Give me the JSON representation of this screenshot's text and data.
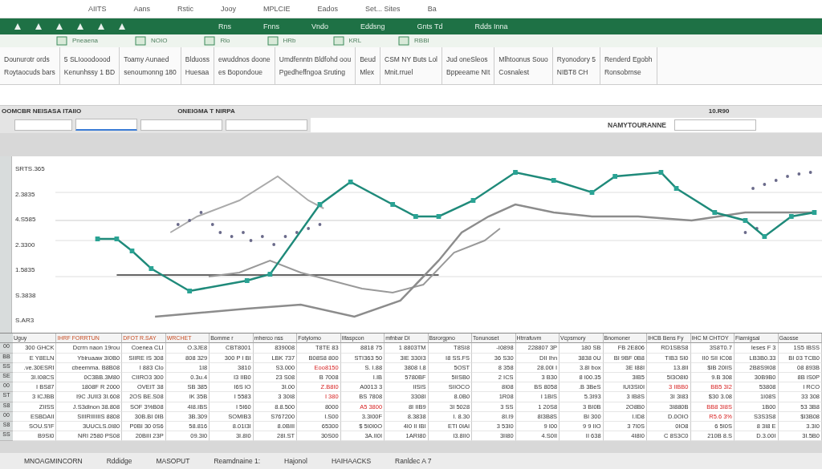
{
  "title_bar": {
    "items": [
      "AIITS",
      "Aans",
      "Rstic",
      "Jooy",
      "MPLCIE",
      "Eados",
      "Set... Sites",
      "Ba"
    ]
  },
  "ribbon_tabs": {
    "items": [
      "Rns",
      "Fnns",
      "Vndo",
      "Eddsng",
      "Gnts Td",
      "Rdds Inna"
    ]
  },
  "ribbon": {
    "top_labels": [
      "Pneaena",
      "NOIO",
      "Rlo",
      "HRb",
      "KRL",
      "RBBI"
    ],
    "groups": [
      {
        "lines": [
          "Dounurotr ords",
          "Roytaocuds bars"
        ]
      },
      {
        "lines": [
          "5 SLIooodoood",
          "Kenunhssy 1 BD"
        ]
      },
      {
        "lines": [
          "Toamy Aunaed",
          "senoumonng 180"
        ]
      },
      {
        "lines": [
          "Blduoss",
          "Huesaa"
        ]
      },
      {
        "lines": [
          "ewuddnos doone",
          "es Bopondoue"
        ]
      },
      {
        "lines": [
          "Umdfenntn Bldfohd oou",
          "Pgedheffngoa Sruting"
        ]
      },
      {
        "lines": [
          "Beud",
          "Mlex"
        ]
      },
      {
        "lines": [
          "CSM NY Buts Lol",
          "Mnit.rruel"
        ]
      },
      {
        "lines": [
          "Jud oneSleos",
          "Bppeeame NIt"
        ]
      },
      {
        "lines": [
          "Mlhtoonus Souo",
          "Cosnalest"
        ]
      },
      {
        "lines": [
          "Ryonodory 5",
          "NIBT8 CH"
        ]
      },
      {
        "lines": [
          "Renderd Egobh",
          "Ronsobrnse"
        ]
      }
    ]
  },
  "labels_row": {
    "left": "OOMCBR NEISASA ITAIIO",
    "middle": "ONEIGMA T NIRPA",
    "right": "10.R90"
  },
  "formula_bar": {
    "label": "NAMYTOURANNE"
  },
  "chart": {
    "y_labels": [
      "SRTS.365",
      "2.3835",
      "4.S585",
      "2.3300",
      "1.5835",
      "S.3838",
      "S.AR3"
    ]
  },
  "table": {
    "columns": [
      "Uguy",
      "IHRF FORRTUN",
      "DFOT R.SAY",
      "WRCHET",
      "Bomme r",
      "mherco nss",
      "Fotyiomo",
      "Ilfaspcon",
      "mfnbar Dl",
      "Bsrorgpno",
      "Tonunoset",
      "Htrrafuvm",
      "Vcpsrnory",
      "Bnomoner",
      "IHCB Bens Fy",
      "IHC M CHTOY",
      "Fiarnigsal",
      "Gaosse"
    ],
    "rows": [
      {
        "num": "00",
        "cells": [
          "300 GHCK",
          "Dcrrn naon 19rou",
          "Coenea CLI",
          "O.3JE8",
          "CBT8001",
          "839008",
          "T8TE 83",
          "8818 75",
          "1 8803TM",
          "T8SI8",
          "-I0898",
          "228807 3P",
          "180 SB",
          "FB 2E806",
          "RD1SBS8",
          "3S8T0.7",
          "Ieses F 3",
          "1S5 IBSS"
        ],
        "negative": [
          false,
          false,
          false,
          false,
          false,
          false,
          false,
          false,
          false,
          false,
          false,
          false,
          false,
          false,
          false,
          false,
          false,
          false
        ]
      },
      {
        "num": "BB",
        "cells": [
          "E Y8ELN",
          "Ybiruaaw 3I0B0",
          "SIIRE IS 308",
          "808 329",
          "300 P I BI",
          "LBK 737",
          "B08S8 800",
          "STI363 50",
          "3IE 330I3",
          "I8 SS.FS",
          "36 S30",
          "DII Ihn",
          "3838 0U",
          "BI 9BF 0B8",
          "TIB3 SI0",
          "II0 SII IC08",
          "LB3B0.33",
          "BI 03 TCB0"
        ],
        "negative": [
          false,
          false,
          false,
          false,
          false,
          false,
          false,
          false,
          false,
          false,
          false,
          false,
          false,
          false,
          false,
          false,
          false,
          false
        ]
      },
      {
        "num": "SS",
        "cells": [
          ".ve.30ESRI",
          "cbeemma. B8B08",
          "I 883 Clo",
          "1I8",
          "3810",
          "S3.000",
          "Eoo8150",
          "S. I.88",
          "3808 I.8",
          "5OST",
          "8 358",
          "28.00I I",
          "3.8I box",
          "3E I88I",
          "13.8II",
          "$IB 20IIS",
          "2B8S9I08",
          "08 893B"
        ],
        "negative": [
          false,
          false,
          false,
          false,
          false,
          false,
          true,
          false,
          false,
          false,
          false,
          false,
          false,
          false,
          false,
          false,
          false,
          false
        ]
      },
      {
        "num": "SE",
        "cells": [
          "3I.I08CS",
          "0C3BB.3M80",
          "CIIRO3 300",
          "0.3u.4",
          "I3 IIB0",
          "23 S08",
          "B 7008",
          "I.IB",
          "5780BF",
          "5IISB0",
          "2 ICS",
          "3 B30",
          "8 I00.35",
          "3IB5",
          "5I3O8I0",
          "9.B 308",
          "30B9B0",
          "8B IS0P"
        ],
        "negative": [
          false,
          false,
          false,
          false,
          false,
          false,
          false,
          false,
          false,
          false,
          false,
          false,
          false,
          false,
          false,
          false,
          false,
          false
        ]
      },
      {
        "num": "00",
        "cells": [
          "I BS87",
          "1808F R 2000",
          "OVEIT 38",
          "SB 385",
          "I6S IO",
          "3I.00",
          "Z.B8I0",
          "A0013 3",
          "IISIS",
          "SIIOCO",
          "8I08",
          "BS 8058",
          ".B 3BeS",
          "IUI3SI0I",
          "3 IIBB0",
          "BB5 3I2",
          "53808",
          "I RCO"
        ],
        "negative": [
          false,
          false,
          false,
          false,
          false,
          false,
          true,
          false,
          false,
          false,
          false,
          false,
          false,
          false,
          true,
          true,
          false,
          false
        ]
      },
      {
        "num": "ST",
        "cells": [
          "3 ICJBB",
          "I9C JUII3 3I.608",
          "2OS BE.S08",
          "IK 35B",
          "I 5583",
          "3 30I8",
          "I 380",
          "BS 7808",
          "3308I",
          "8.0B0",
          "1R08",
          "I 1BIS",
          "5.3I93",
          "3 IB8S",
          "3I 3I83",
          "$30 3.08",
          "1I08S",
          "33 308"
        ],
        "negative": [
          false,
          false,
          false,
          false,
          false,
          false,
          true,
          false,
          false,
          false,
          false,
          false,
          false,
          false,
          false,
          false,
          false,
          false
        ]
      },
      {
        "num": "S8",
        "cells": [
          "ZIISS",
          "J.S3dlnon 38.808",
          "SOF 3%B08",
          "4I8.IBS",
          "I 5I60",
          "8.8.500",
          "8000",
          "A5 3800",
          "8I IIB9",
          "3I 5028",
          "3 SS",
          "1 20S8",
          "3 BI0B",
          "2O8B0",
          "3I880B",
          "BB8 3I8S",
          "1B00",
          "53 3B8"
        ],
        "negative": [
          false,
          false,
          false,
          false,
          false,
          false,
          false,
          true,
          false,
          false,
          false,
          false,
          false,
          false,
          false,
          true,
          false,
          false
        ]
      },
      {
        "num": "00",
        "cells": [
          "ESBDAII",
          "SIIIRIIIIIIS 8808",
          "30B.BI 0IB",
          "3B.309",
          "SOMIB3",
          "S767200",
          "I.S00",
          "3.3I00F",
          "8.3838",
          "I. 8.30",
          "8I.I9",
          "8I3B8S",
          "BI 300",
          "I.ID8",
          "D.0OIO",
          "R5.6 3%",
          "S3S3S8",
          "$I3B08"
        ],
        "negative": [
          false,
          false,
          false,
          false,
          false,
          false,
          false,
          false,
          false,
          false,
          false,
          false,
          false,
          false,
          false,
          true,
          false,
          false
        ]
      },
      {
        "num": "S8",
        "cells": [
          "SOU.S'IF",
          "3UUCLS.0I80",
          "P0BI 30 0S6",
          "58.816",
          "8.01I3I",
          "8.0BIII",
          "65300",
          "$ 5I0I0O",
          "4I0 II IBI",
          "ETI 0IAI",
          "3 53I0",
          "9 I00",
          "9 9 IIO",
          "3 7I0S",
          "0IO8",
          "6 5I0S",
          "8 3I8 E",
          "3.3I0"
        ],
        "negative": [
          false,
          false,
          false,
          false,
          false,
          false,
          false,
          false,
          false,
          false,
          false,
          false,
          false,
          false,
          false,
          false,
          false,
          false
        ]
      },
      {
        "num": "SS",
        "cells": [
          "B9SI0",
          "NRI 2580 PS08",
          "20BIII 23P",
          "09.3I0",
          "3I.8I0",
          "28I.ST",
          "30S00",
          "3A.II0I",
          "1ARI80",
          "I3.8II0",
          "3II80",
          "4.S0II",
          "II 638",
          "4I8I0",
          "C 8S3C0",
          "210B 8.S",
          "D.3.00I",
          "3I.5B0"
        ],
        "negative": [
          false,
          false,
          false,
          false,
          false,
          false,
          false,
          false,
          false,
          false,
          false,
          false,
          false,
          false,
          false,
          false,
          false,
          false
        ]
      }
    ]
  },
  "status_bar": {
    "items": [
      "MNOAGMINCORN",
      "Rddidge",
      "MASOPUT",
      "Reamdnaine 1:",
      "Hajonol",
      "HAIHAACKS",
      "Ranldec A 7"
    ]
  }
}
